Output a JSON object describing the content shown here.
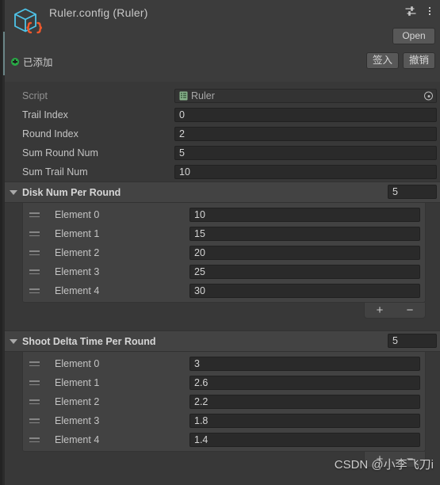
{
  "window": {
    "edge_accent_color": "#9ecfd4",
    "background_color": "#383838"
  },
  "header": {
    "title": "Ruler.config (Ruler)",
    "asset_icon": "scriptable-object-json-cube-icon",
    "asset_icon_color": "#4ec3e8",
    "asset_icon_brace_color": "#f0582b",
    "preset_icon": "preset-sliders-icon",
    "menu_icon": "kebab-menu-icon",
    "open_label": "Open",
    "vcs_status": "已添加",
    "vcs_status_icon": "green-plus-badge-icon",
    "vcs_status_color": "#28a745",
    "vcs_buttons": [
      {
        "label": "签入",
        "name": "check-in-button"
      },
      {
        "label": "撤销",
        "name": "revert-button"
      }
    ]
  },
  "properties": [
    {
      "label": "Script",
      "value": "Ruler",
      "type": "object",
      "icon": "csharp-script-icon",
      "disabled": true
    },
    {
      "label": "Trail Index",
      "value": "0",
      "type": "int"
    },
    {
      "label": "Round Index",
      "value": "2",
      "type": "int"
    },
    {
      "label": "Sum Round Num",
      "value": "5",
      "type": "int"
    },
    {
      "label": "Sum Trail Num",
      "value": "10",
      "type": "int"
    }
  ],
  "arrays": [
    {
      "name": "disk-num-per-round",
      "title": "Disk Num Per Round",
      "size": "5",
      "expanded": true,
      "elements": [
        {
          "label": "Element 0",
          "value": "10"
        },
        {
          "label": "Element 1",
          "value": "15"
        },
        {
          "label": "Element 2",
          "value": "20"
        },
        {
          "label": "Element 3",
          "value": "25"
        },
        {
          "label": "Element 4",
          "value": "30"
        }
      ],
      "add_label": "+",
      "remove_label": "−"
    },
    {
      "name": "shoot-delta-time-per-round",
      "title": "Shoot Delta Time Per Round",
      "size": "5",
      "expanded": true,
      "elements": [
        {
          "label": "Element 0",
          "value": "3"
        },
        {
          "label": "Element 1",
          "value": "2.6"
        },
        {
          "label": "Element 2",
          "value": "2.2"
        },
        {
          "label": "Element 3",
          "value": "1.8"
        },
        {
          "label": "Element 4",
          "value": "1.4"
        }
      ],
      "add_label": "+",
      "remove_label": "−"
    }
  ],
  "watermark": "CSDN @小李飞刀i"
}
